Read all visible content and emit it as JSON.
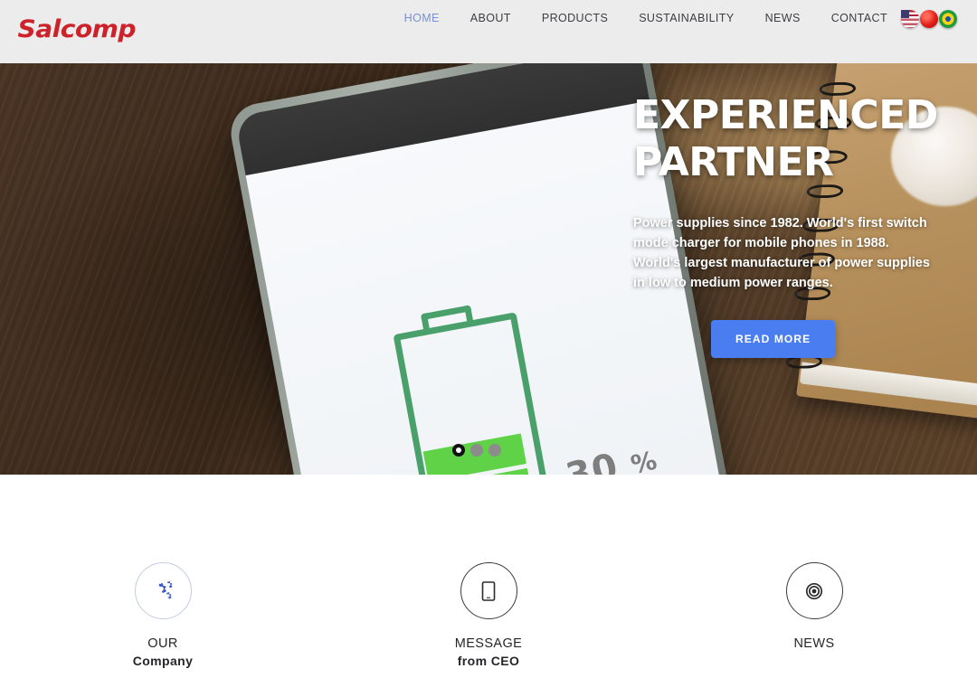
{
  "header": {
    "logo_text": "Salcomp",
    "logo_color": "#cc2229",
    "nav": [
      {
        "label": "HOME",
        "active": true
      },
      {
        "label": "ABOUT",
        "active": false
      },
      {
        "label": "PRODUCTS",
        "active": false
      },
      {
        "label": "SUSTAINABILITY",
        "active": false
      },
      {
        "label": "NEWS",
        "active": false
      },
      {
        "label": "CONTACT",
        "active": false
      }
    ],
    "active_color": "#7b8fd4",
    "flags": [
      {
        "name": "flag-united-states-icon",
        "label": "United States"
      },
      {
        "name": "flag-china-icon",
        "label": "China"
      },
      {
        "name": "flag-brazil-icon",
        "label": "Brazil"
      }
    ]
  },
  "hero": {
    "title_line1": "EXPERIENCED",
    "title_line2": "PARTNER",
    "paragraph": "Power supplies since 1982. World's first switch mode charger for mobile phones in 1988. World's largest manufacturer of power supplies in low to medium power ranges.",
    "cta_label": "READ MORE",
    "cta_color": "#4a7ef0",
    "battery_percent": "30",
    "battery_percent_symbol": "%",
    "battery_color": "#5fd247",
    "slides": [
      {
        "active": true
      },
      {
        "active": false
      },
      {
        "active": false
      }
    ]
  },
  "features": [
    {
      "icon": "gears-icon",
      "title_top": "OUR",
      "title_sub": "Company",
      "icon_color": "#3b5bc0",
      "circle_style": "blue"
    },
    {
      "icon": "tablet-icon",
      "title_top": "MESSAGE",
      "title_sub": "from CEO",
      "icon_color": "#2b2b2b",
      "circle_style": "dark"
    },
    {
      "icon": "target-icon",
      "title_top": "NEWS",
      "title_sub": "",
      "icon_color": "#2b2b2b",
      "circle_style": "dark"
    }
  ]
}
